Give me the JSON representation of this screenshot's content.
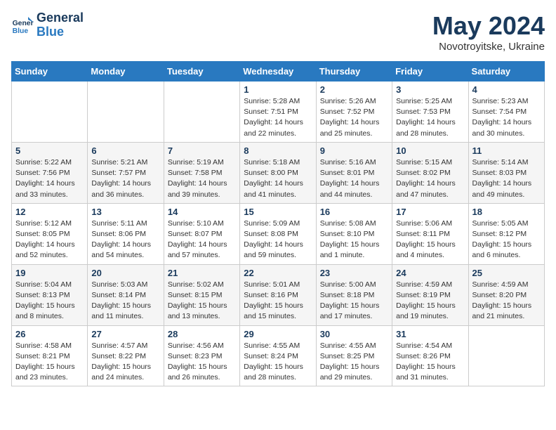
{
  "header": {
    "logo_line1": "General",
    "logo_line2": "Blue",
    "month": "May 2024",
    "location": "Novotroyitske, Ukraine"
  },
  "weekdays": [
    "Sunday",
    "Monday",
    "Tuesday",
    "Wednesday",
    "Thursday",
    "Friday",
    "Saturday"
  ],
  "weeks": [
    [
      {
        "day": "",
        "info": ""
      },
      {
        "day": "",
        "info": ""
      },
      {
        "day": "",
        "info": ""
      },
      {
        "day": "1",
        "info": "Sunrise: 5:28 AM\nSunset: 7:51 PM\nDaylight: 14 hours\nand 22 minutes."
      },
      {
        "day": "2",
        "info": "Sunrise: 5:26 AM\nSunset: 7:52 PM\nDaylight: 14 hours\nand 25 minutes."
      },
      {
        "day": "3",
        "info": "Sunrise: 5:25 AM\nSunset: 7:53 PM\nDaylight: 14 hours\nand 28 minutes."
      },
      {
        "day": "4",
        "info": "Sunrise: 5:23 AM\nSunset: 7:54 PM\nDaylight: 14 hours\nand 30 minutes."
      }
    ],
    [
      {
        "day": "5",
        "info": "Sunrise: 5:22 AM\nSunset: 7:56 PM\nDaylight: 14 hours\nand 33 minutes."
      },
      {
        "day": "6",
        "info": "Sunrise: 5:21 AM\nSunset: 7:57 PM\nDaylight: 14 hours\nand 36 minutes."
      },
      {
        "day": "7",
        "info": "Sunrise: 5:19 AM\nSunset: 7:58 PM\nDaylight: 14 hours\nand 39 minutes."
      },
      {
        "day": "8",
        "info": "Sunrise: 5:18 AM\nSunset: 8:00 PM\nDaylight: 14 hours\nand 41 minutes."
      },
      {
        "day": "9",
        "info": "Sunrise: 5:16 AM\nSunset: 8:01 PM\nDaylight: 14 hours\nand 44 minutes."
      },
      {
        "day": "10",
        "info": "Sunrise: 5:15 AM\nSunset: 8:02 PM\nDaylight: 14 hours\nand 47 minutes."
      },
      {
        "day": "11",
        "info": "Sunrise: 5:14 AM\nSunset: 8:03 PM\nDaylight: 14 hours\nand 49 minutes."
      }
    ],
    [
      {
        "day": "12",
        "info": "Sunrise: 5:12 AM\nSunset: 8:05 PM\nDaylight: 14 hours\nand 52 minutes."
      },
      {
        "day": "13",
        "info": "Sunrise: 5:11 AM\nSunset: 8:06 PM\nDaylight: 14 hours\nand 54 minutes."
      },
      {
        "day": "14",
        "info": "Sunrise: 5:10 AM\nSunset: 8:07 PM\nDaylight: 14 hours\nand 57 minutes."
      },
      {
        "day": "15",
        "info": "Sunrise: 5:09 AM\nSunset: 8:08 PM\nDaylight: 14 hours\nand 59 minutes."
      },
      {
        "day": "16",
        "info": "Sunrise: 5:08 AM\nSunset: 8:10 PM\nDaylight: 15 hours\nand 1 minute."
      },
      {
        "day": "17",
        "info": "Sunrise: 5:06 AM\nSunset: 8:11 PM\nDaylight: 15 hours\nand 4 minutes."
      },
      {
        "day": "18",
        "info": "Sunrise: 5:05 AM\nSunset: 8:12 PM\nDaylight: 15 hours\nand 6 minutes."
      }
    ],
    [
      {
        "day": "19",
        "info": "Sunrise: 5:04 AM\nSunset: 8:13 PM\nDaylight: 15 hours\nand 8 minutes."
      },
      {
        "day": "20",
        "info": "Sunrise: 5:03 AM\nSunset: 8:14 PM\nDaylight: 15 hours\nand 11 minutes."
      },
      {
        "day": "21",
        "info": "Sunrise: 5:02 AM\nSunset: 8:15 PM\nDaylight: 15 hours\nand 13 minutes."
      },
      {
        "day": "22",
        "info": "Sunrise: 5:01 AM\nSunset: 8:16 PM\nDaylight: 15 hours\nand 15 minutes."
      },
      {
        "day": "23",
        "info": "Sunrise: 5:00 AM\nSunset: 8:18 PM\nDaylight: 15 hours\nand 17 minutes."
      },
      {
        "day": "24",
        "info": "Sunrise: 4:59 AM\nSunset: 8:19 PM\nDaylight: 15 hours\nand 19 minutes."
      },
      {
        "day": "25",
        "info": "Sunrise: 4:59 AM\nSunset: 8:20 PM\nDaylight: 15 hours\nand 21 minutes."
      }
    ],
    [
      {
        "day": "26",
        "info": "Sunrise: 4:58 AM\nSunset: 8:21 PM\nDaylight: 15 hours\nand 23 minutes."
      },
      {
        "day": "27",
        "info": "Sunrise: 4:57 AM\nSunset: 8:22 PM\nDaylight: 15 hours\nand 24 minutes."
      },
      {
        "day": "28",
        "info": "Sunrise: 4:56 AM\nSunset: 8:23 PM\nDaylight: 15 hours\nand 26 minutes."
      },
      {
        "day": "29",
        "info": "Sunrise: 4:55 AM\nSunset: 8:24 PM\nDaylight: 15 hours\nand 28 minutes."
      },
      {
        "day": "30",
        "info": "Sunrise: 4:55 AM\nSunset: 8:25 PM\nDaylight: 15 hours\nand 29 minutes."
      },
      {
        "day": "31",
        "info": "Sunrise: 4:54 AM\nSunset: 8:26 PM\nDaylight: 15 hours\nand 31 minutes."
      },
      {
        "day": "",
        "info": ""
      }
    ]
  ]
}
